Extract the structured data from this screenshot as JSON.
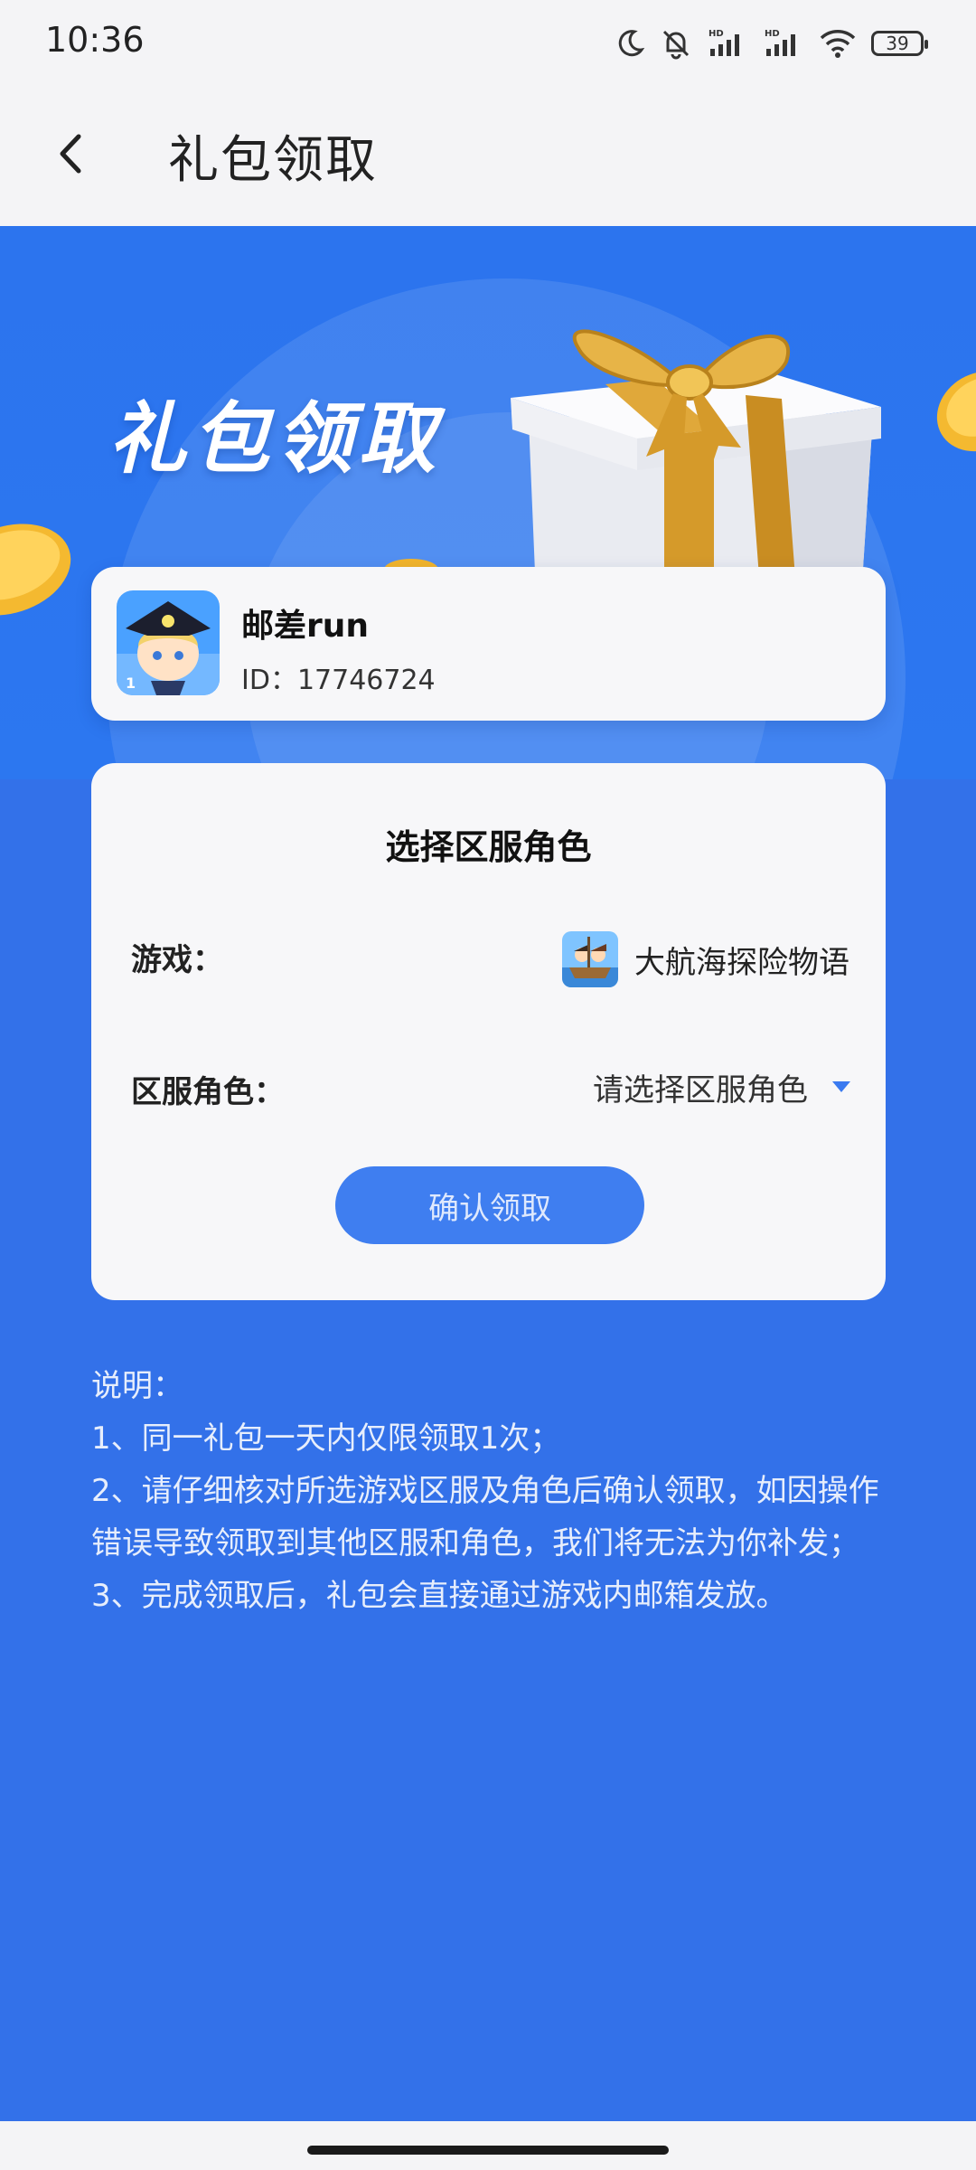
{
  "status_bar": {
    "time": "10:36",
    "battery": "39",
    "icons": [
      "moon-icon",
      "bell-off-icon",
      "signal-hd-icon",
      "signal-hd-icon",
      "wifi-icon",
      "battery-icon"
    ]
  },
  "header": {
    "back_icon": "chevron-left-icon",
    "title": "礼包领取"
  },
  "hero": {
    "title": "礼包领取"
  },
  "user": {
    "name": "邮差run",
    "id_text": "ID：17746724"
  },
  "select_card": {
    "title": "选择区服角色",
    "game_label": "游戏：",
    "game_name": "大航海探险物语",
    "role_label": "区服角色：",
    "role_placeholder": "请选择区服角色",
    "confirm_label": "确认领取"
  },
  "notes": {
    "heading": "说明：",
    "items": [
      "1、同一礼包一天内仅限领取1次；",
      "2、请仔细核对所选游戏区服及角色后确认领取，如因操作错误导致领取到其他区服和角色，我们将无法为你补发；",
      "3、完成领取后，礼包会直接通过游戏内邮箱发放。"
    ]
  },
  "colors": {
    "background": "#3371e9",
    "hero": "#2c74ee",
    "button": "#3f7ef0",
    "card": "#f7f7f9",
    "dropdown_arrow": "#3a7af0"
  }
}
